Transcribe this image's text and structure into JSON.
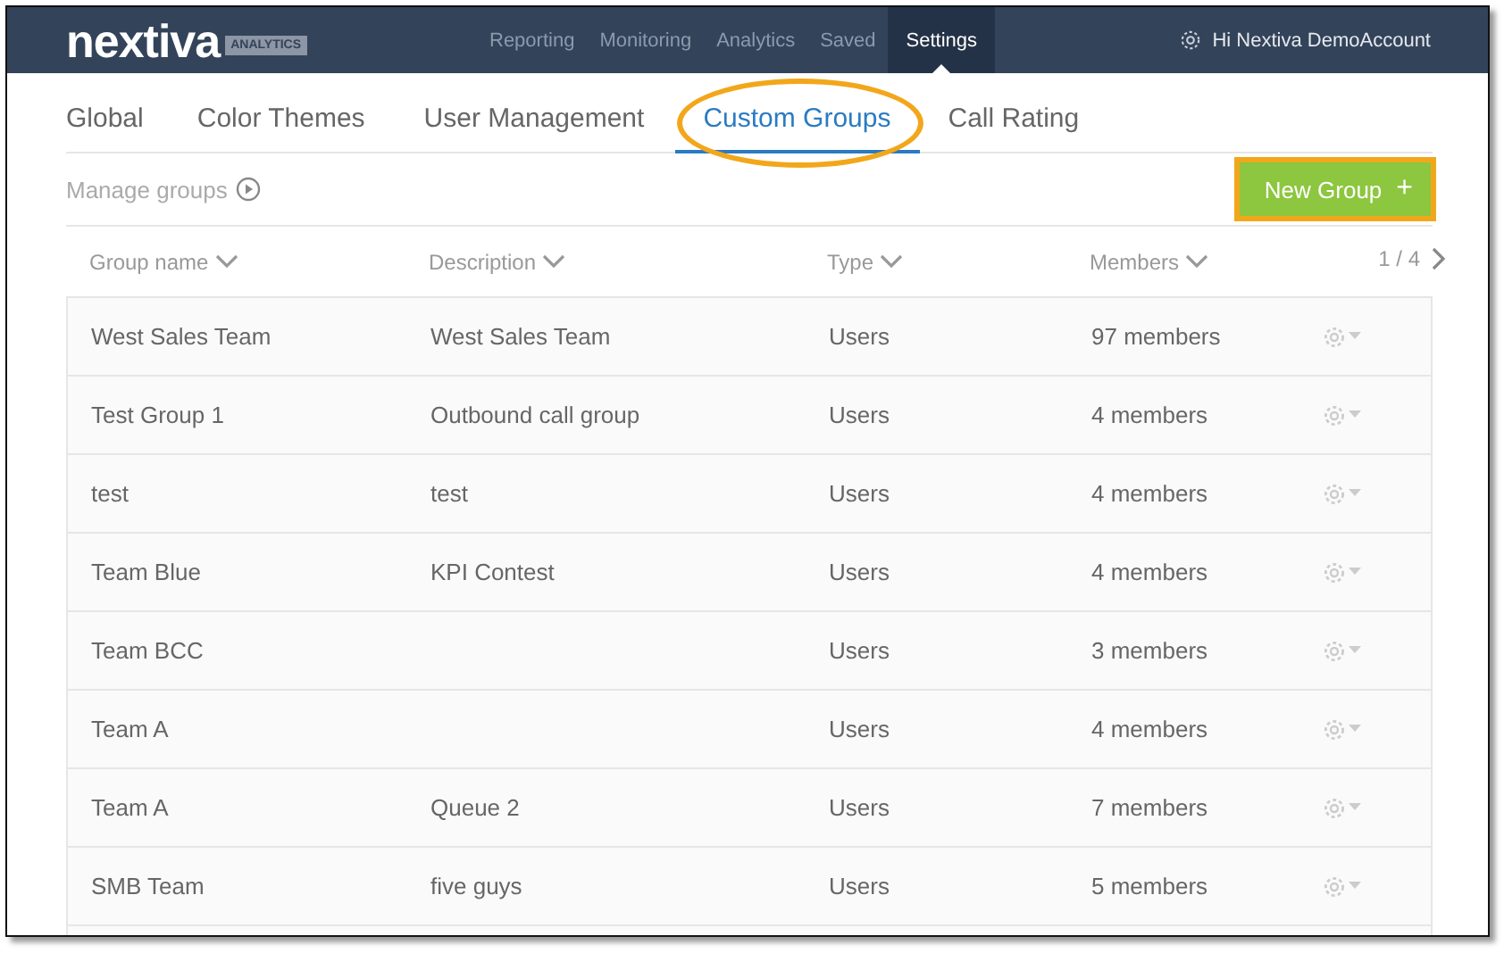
{
  "header": {
    "logo": "nextiva",
    "logo_badge": "ANALYTICS",
    "nav": [
      {
        "label": "Reporting",
        "selected": false
      },
      {
        "label": "Monitoring",
        "selected": false
      },
      {
        "label": "Analytics",
        "selected": false
      },
      {
        "label": "Saved",
        "selected": false
      },
      {
        "label": "Settings",
        "selected": true
      }
    ],
    "user": "Hi Nextiva DemoAccount"
  },
  "tabs": [
    {
      "label": "Global",
      "selected": false,
      "highlighted": false
    },
    {
      "label": "Color Themes",
      "selected": false,
      "highlighted": false
    },
    {
      "label": "User Management",
      "selected": false,
      "highlighted": false
    },
    {
      "label": "Custom Groups",
      "selected": true,
      "highlighted": true
    },
    {
      "label": "Call Rating",
      "selected": false,
      "highlighted": false
    }
  ],
  "toolbar": {
    "title": "Manage groups",
    "button": {
      "label": "New Group",
      "icon": "+",
      "highlighted": true
    }
  },
  "table": {
    "columns": [
      "Group name",
      "Description",
      "Type",
      "Members"
    ],
    "pager": "1 / 4",
    "rows": [
      {
        "name": "West Sales Team",
        "description": "West Sales Team",
        "type": "Users",
        "members": "97 members"
      },
      {
        "name": "Test Group 1",
        "description": "Outbound call group",
        "type": "Users",
        "members": "4 members"
      },
      {
        "name": "test",
        "description": "test",
        "type": "Users",
        "members": "4 members"
      },
      {
        "name": "Team Blue",
        "description": "KPI Contest",
        "type": "Users",
        "members": "4 members"
      },
      {
        "name": "Team BCC",
        "description": "",
        "type": "Users",
        "members": "3 members"
      },
      {
        "name": "Team A",
        "description": "",
        "type": "Users",
        "members": "4 members"
      },
      {
        "name": "Team A",
        "description": "Queue 2",
        "type": "Users",
        "members": "7 members"
      },
      {
        "name": "SMB Team",
        "description": "five guys",
        "type": "Users",
        "members": "5 members"
      }
    ]
  }
}
